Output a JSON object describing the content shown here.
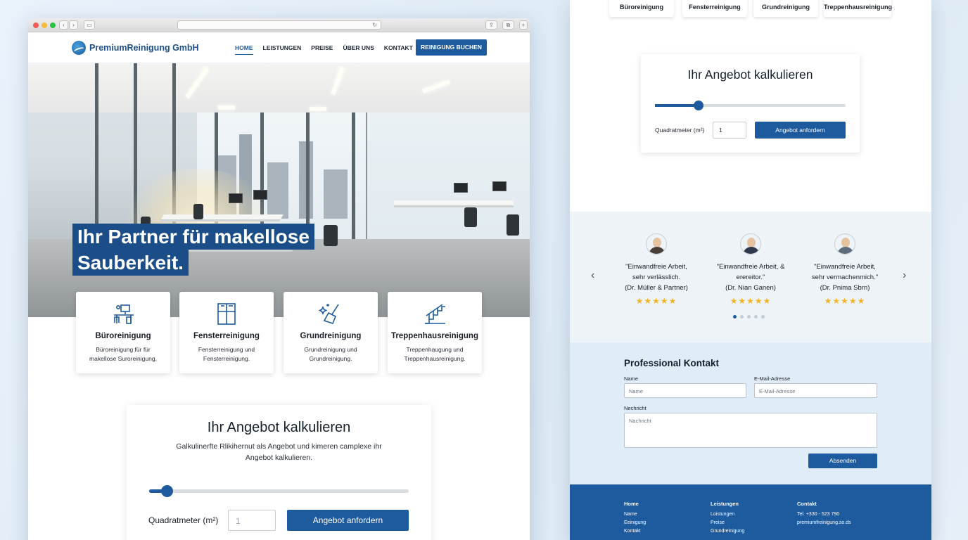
{
  "browser": {
    "url": "",
    "reload_glyph": "↻",
    "back_glyph": "‹",
    "forward_glyph": "›"
  },
  "site": {
    "logo_text": "PremiumReinigung GmbH",
    "nav": [
      "HOME",
      "LEISTUNGEN",
      "PREISE",
      "ÜBER UNS",
      "KONTAKT"
    ],
    "nav_active": "HOME",
    "cta": "REINIGUNG BUCHEN"
  },
  "hero": {
    "title_line1": "Ihr Partner für makellose",
    "title_line2": "Sauberkeit."
  },
  "services": [
    {
      "icon": "office-desk-icon",
      "title": "Büroreinigung",
      "desc_line1": "Büroreinigung für für",
      "desc_line2": "makellose Suroreinigung."
    },
    {
      "icon": "window-icon",
      "title": "Fensterreinigung",
      "desc_line1": "Fensterreinigung und",
      "desc_line2": "Fensterreinigung."
    },
    {
      "icon": "broom-icon",
      "title": "Grundreinigung",
      "desc_line1": "Grundreinigung und",
      "desc_line2": "Grundreinigung."
    },
    {
      "icon": "stairs-icon",
      "title": "Treppenhausreinigung",
      "desc_line1": "Treppenhaugung und",
      "desc_line2": "Treppenhausreinigung."
    }
  ],
  "calculator": {
    "title": "Ihr Angebot kalkulieren",
    "subtitle_line1": "Galkulinerfte Rlikihernut als Angebot und kimeren camplexe ihr",
    "subtitle_line2": "Angebot kalkulieren.",
    "slider_value": 0.07,
    "qm_label": "Quadratmeter (m²)",
    "qm_placeholder": "1",
    "button": "Angebot anfordern"
  },
  "right_page": {
    "tabs": [
      "Büroreinigung",
      "Fensterreinigung",
      "Grundreinigung",
      "Treppenhausreinigung"
    ],
    "calculator": {
      "title": "Ihr Angebot kalkulieren",
      "slider_value": 0.23,
      "qm_label": "Quadratmeter (m²)",
      "qm_value": "1",
      "button": "Angebot anfordern"
    },
    "testimonials": [
      {
        "quote_line1": "\"Einwandfreie Arbeit,",
        "quote_line2": "sehr verlässlich.",
        "author": "(Dr. Müller & Partner)",
        "stars": "★★★★★"
      },
      {
        "quote_line1": "\"Einwandfreie Arbeit, &",
        "quote_line2": "erereitor.\"",
        "author": "(Dr. Nian Ganen)",
        "stars": "★★★★★"
      },
      {
        "quote_line1": "\"Einwandfreie Arbeit,",
        "quote_line2": "sehr vermachenmich.\"",
        "author": "(Dr. Pnima Sbrn)",
        "stars": "★★★★★"
      }
    ],
    "carousel_prev": "‹",
    "carousel_next": "›",
    "carousel_active_dot": 0,
    "carousel_dot_count": 5,
    "contact": {
      "title": "Professional Kontakt",
      "name_label": "Name",
      "name_placeholder": "Name",
      "email_label": "E-Mail-Adresse",
      "email_placeholder": "E-Mail-Adresse",
      "message_label": "Nechricht",
      "message_placeholder": "Nachricht",
      "send": "Absenden"
    },
    "footer": {
      "col1": {
        "title": "Home",
        "items": [
          "Name",
          "Eeinigung",
          "Kontakt"
        ]
      },
      "col2": {
        "title": "Leistungen",
        "items": [
          "Loistungen",
          "Preise",
          "Grundreinigung"
        ]
      },
      "col3": {
        "title": "Contakt",
        "items": [
          "Tel. +330 - 523 790",
          "premiumfreinigung.so.ds"
        ]
      }
    }
  },
  "colors": {
    "brand_blue": "#1d5a9e",
    "star": "#f0b42a",
    "background": "#e3eef8"
  }
}
